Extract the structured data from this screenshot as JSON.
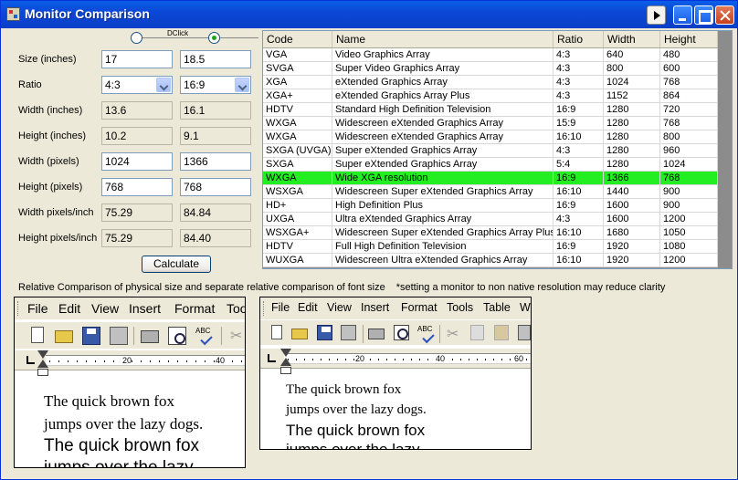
{
  "window": {
    "title": "Monitor Comparison"
  },
  "toggle": {
    "label": "DClick"
  },
  "form": {
    "rows": [
      {
        "label": "Size (inches)",
        "left": "17",
        "right": "18.5",
        "kind": "input"
      },
      {
        "label": "Ratio",
        "left": "4:3",
        "right": "16:9",
        "kind": "combo"
      },
      {
        "label": "Width (inches)",
        "left": "13.6",
        "right": "16.1",
        "kind": "readonly"
      },
      {
        "label": "Height (inches)",
        "left": "10.2",
        "right": "9.1",
        "kind": "readonly"
      },
      {
        "label": "Width (pixels)",
        "left": "1024",
        "right": "1366",
        "kind": "input"
      },
      {
        "label": "Height (pixels)",
        "left": "768",
        "right": "768",
        "kind": "input"
      },
      {
        "label": "Width pixels/inch",
        "left": "75.29",
        "right": "84.84",
        "kind": "readonly"
      },
      {
        "label": "Height pixels/inch",
        "left": "75.29",
        "right": "84.40",
        "kind": "readonly"
      }
    ],
    "calculate_label": "Calculate"
  },
  "grid": {
    "columns": [
      "Code",
      "Name",
      "Ratio",
      "Width",
      "Height"
    ],
    "selected_index": 9,
    "rows": [
      [
        "VGA",
        "Video Graphics Array",
        "4:3",
        "640",
        "480"
      ],
      [
        "SVGA",
        "Super Video Graphics Array",
        "4:3",
        "800",
        "600"
      ],
      [
        "XGA",
        "eXtended Graphics Array",
        "4:3",
        "1024",
        "768"
      ],
      [
        "XGA+",
        "eXtended Graphics Array Plus",
        "4:3",
        "1152",
        "864"
      ],
      [
        "HDTV",
        "Standard High Definition Television",
        "16:9",
        "1280",
        "720"
      ],
      [
        "WXGA",
        "Widescreen eXtended Graphics Array",
        "15:9",
        "1280",
        "768"
      ],
      [
        "WXGA",
        "Widescreen eXtended Graphics Array",
        "16:10",
        "1280",
        "800"
      ],
      [
        "SXGA (UVGA)",
        "Super eXtended Graphics Array",
        "4:3",
        "1280",
        "960"
      ],
      [
        "SXGA",
        "Super eXtended Graphics Array",
        "5:4",
        "1280",
        "1024"
      ],
      [
        "WXGA",
        "Wide XGA resolution",
        "16:9",
        "1366",
        "768"
      ],
      [
        "WSXGA",
        "Widescreen Super eXtended Graphics Array",
        "16:10",
        "1440",
        "900"
      ],
      [
        "HD+",
        "High Definition Plus",
        "16:9",
        "1600",
        "900"
      ],
      [
        "UXGA",
        "Ultra eXtended Graphics Array",
        "4:3",
        "1600",
        "1200"
      ],
      [
        "WSXGA+",
        "Widescreen Super eXtended Graphics Array Plus",
        "16:10",
        "1680",
        "1050"
      ],
      [
        "HDTV",
        "Full High Definition Television",
        "16:9",
        "1920",
        "1080"
      ],
      [
        "WUXGA",
        "Widescreen Ultra eXtended Graphics Array",
        "16:10",
        "1920",
        "1200"
      ]
    ]
  },
  "note": {
    "relative": "Relative Comparison of physical size and separate relative comparison of font size",
    "warning": "*setting a monitor to non native resolution may reduce clarity"
  },
  "preview_left": {
    "menu": [
      "File",
      "Edit",
      "View",
      "Insert",
      "Format",
      "Too"
    ],
    "ruler": [
      "20",
      "40"
    ],
    "lines": [
      "The quick brown fox",
      "jumps over the lazy dogs.",
      "The quick brown fox",
      "jumps over the lazy"
    ]
  },
  "preview_right": {
    "menu": [
      "File",
      "Edit",
      "View",
      "Insert",
      "Format",
      "Tools",
      "Table",
      "Wi"
    ],
    "ruler": [
      "20",
      "40",
      "60"
    ],
    "lines": [
      "The quick brown fox",
      "jumps over the lazy dogs.",
      "The quick brown fox",
      "jumps over the lazy"
    ]
  }
}
